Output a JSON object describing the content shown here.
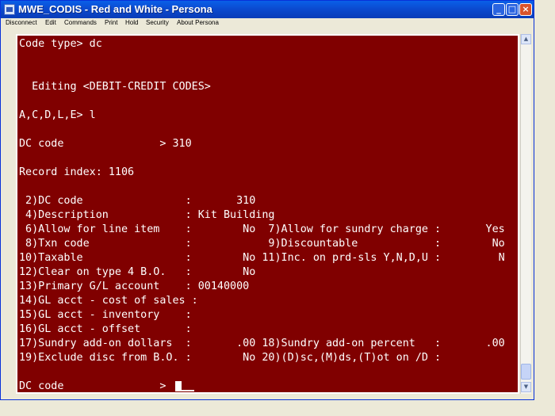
{
  "window": {
    "title": "MWE_CODIS - Red and White - Persona"
  },
  "controls": {
    "minimize": "_",
    "maximize": "□",
    "close": "×"
  },
  "menu": [
    "Disconnect",
    "Edit",
    "Commands",
    "Print",
    "Hold",
    "Security",
    "About Persona"
  ],
  "terminal": {
    "lines": [
      "Code type> dc",
      "",
      "",
      "  Editing <DEBIT-CREDIT CODES>",
      "",
      "A,C,D,L,E> l",
      "",
      "DC code               > 310",
      "",
      "Record index: 1106",
      "",
      " 2)DC code                :       310",
      " 4)Description            : Kit Building",
      " 6)Allow for line item    :        No  7)Allow for sundry charge :       Yes",
      " 8)Txn code               :            9)Discountable            :        No",
      "10)Taxable                :        No 11)Inc. on prd-sls Y,N,D,U :         N",
      "12)Clear on type 4 B.O.   :        No",
      "13)Primary G/L account    : 00140000",
      "14)GL acct - cost of sales :",
      "15)GL acct - inventory    :",
      "16)GL acct - offset       :",
      "17)Sundry add-on dollars  :       .00 18)Sundry add-on percent   :       .00",
      "19)Exclude disc from B.O. :        No 20)(D)sc,(M)ds,(T)ot on /D :",
      "",
      "DC code               >"
    ]
  },
  "colors": {
    "terminal_bg": "#800000",
    "terminal_fg": "#ffffff",
    "titlebar": "#0b4bd0"
  },
  "icons": {
    "scroll_up": "▲",
    "scroll_down": "▼"
  }
}
